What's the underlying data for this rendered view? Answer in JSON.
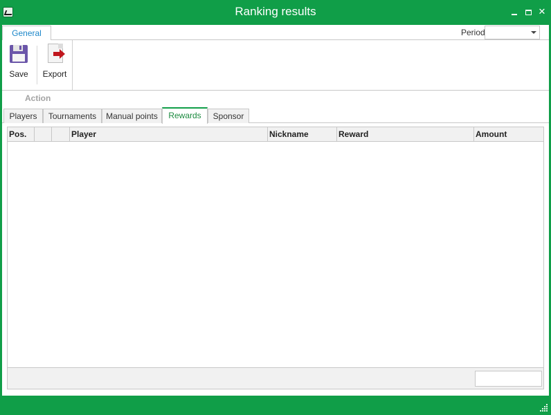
{
  "window": {
    "title": "Ranking results"
  },
  "ribbon": {
    "tab_label": "General",
    "period_label": "Period",
    "period_value": "",
    "buttons": {
      "save": {
        "label": "Save",
        "icon": "floppy-disk-icon"
      },
      "export": {
        "label": "Export",
        "icon": "export-icon"
      }
    },
    "group_caption": "Action"
  },
  "tabs": [
    {
      "label": "Players"
    },
    {
      "label": "Tournaments"
    },
    {
      "label": "Manual points"
    },
    {
      "label": "Rewards",
      "active": true
    },
    {
      "label": "Sponsor"
    }
  ],
  "grid": {
    "columns": [
      "Pos.",
      "",
      "",
      "Player",
      "Nickname",
      "Reward",
      "Amount"
    ],
    "rows": [],
    "footer_summary": ""
  },
  "colors": {
    "brand_green": "#109e48",
    "active_tab_text": "#1a8a3e",
    "ribbon_tab_text": "#1b86c9",
    "export_arrow": "#c0161d",
    "save_icon": "#6b56a9"
  }
}
